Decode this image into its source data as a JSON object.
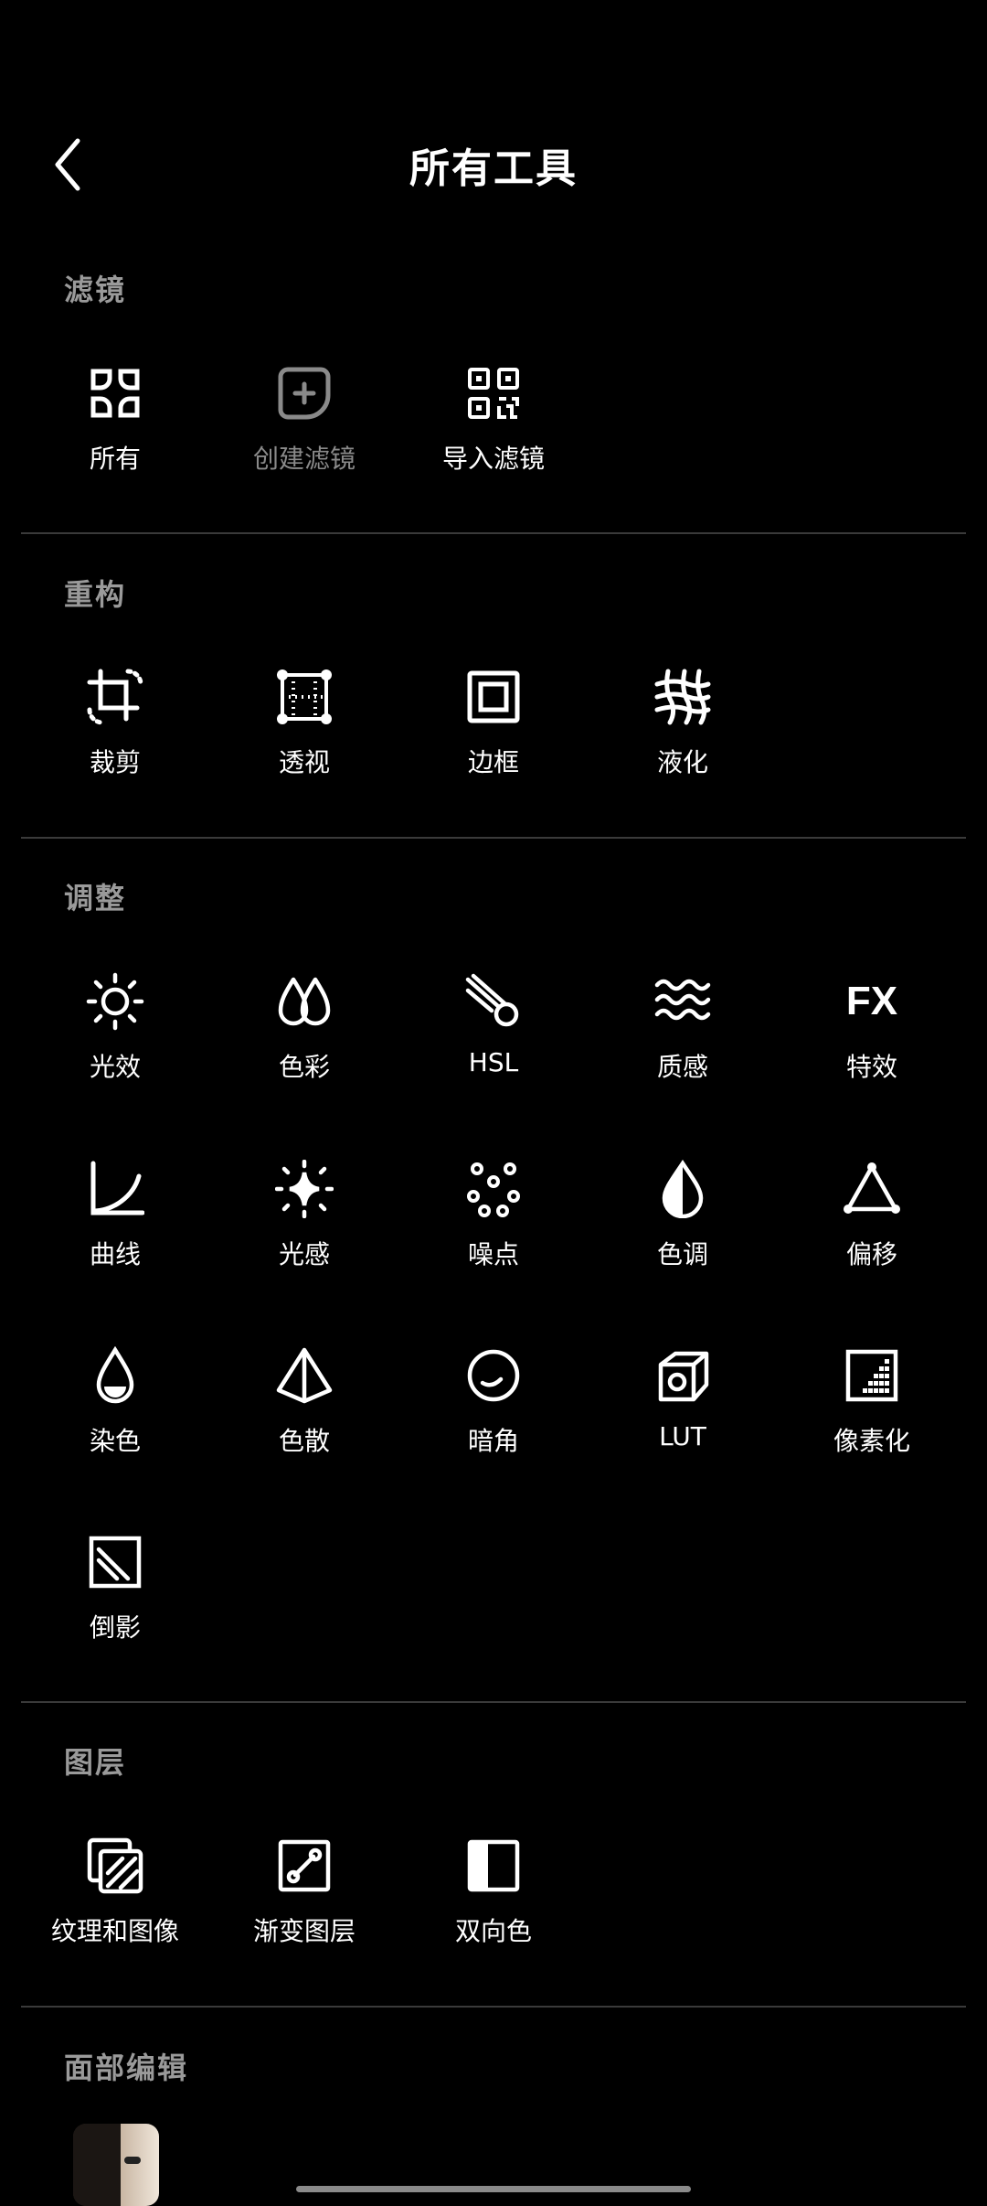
{
  "header": {
    "title": "所有工具"
  },
  "sections": {
    "filters": {
      "title": "滤镜",
      "items": [
        {
          "label": "所有"
        },
        {
          "label": "创建滤镜"
        },
        {
          "label": "导入滤镜"
        }
      ]
    },
    "recompose": {
      "title": "重构",
      "items": [
        {
          "label": "裁剪"
        },
        {
          "label": "透视"
        },
        {
          "label": "边框"
        },
        {
          "label": "液化"
        }
      ]
    },
    "adjust": {
      "title": "调整",
      "items": [
        {
          "label": "光效"
        },
        {
          "label": "色彩"
        },
        {
          "label": "HSL"
        },
        {
          "label": "质感"
        },
        {
          "label": "特效"
        },
        {
          "label": "曲线"
        },
        {
          "label": "光感"
        },
        {
          "label": "噪点"
        },
        {
          "label": "色调"
        },
        {
          "label": "偏移"
        },
        {
          "label": "染色"
        },
        {
          "label": "色散"
        },
        {
          "label": "暗角"
        },
        {
          "label": "LUT"
        },
        {
          "label": "像素化"
        },
        {
          "label": "倒影"
        }
      ]
    },
    "layers": {
      "title": "图层",
      "items": [
        {
          "label": "纹理和图像"
        },
        {
          "label": "渐变图层"
        },
        {
          "label": "双向色"
        }
      ]
    },
    "face": {
      "title": "面部编辑"
    }
  },
  "icons": {
    "fx_text": "FX"
  },
  "colors": {
    "background": "#000000",
    "text": "#ffffff",
    "section_title": "#9a9a9a",
    "disabled": "#8a8a8a",
    "divider": "#3a3a3a"
  }
}
